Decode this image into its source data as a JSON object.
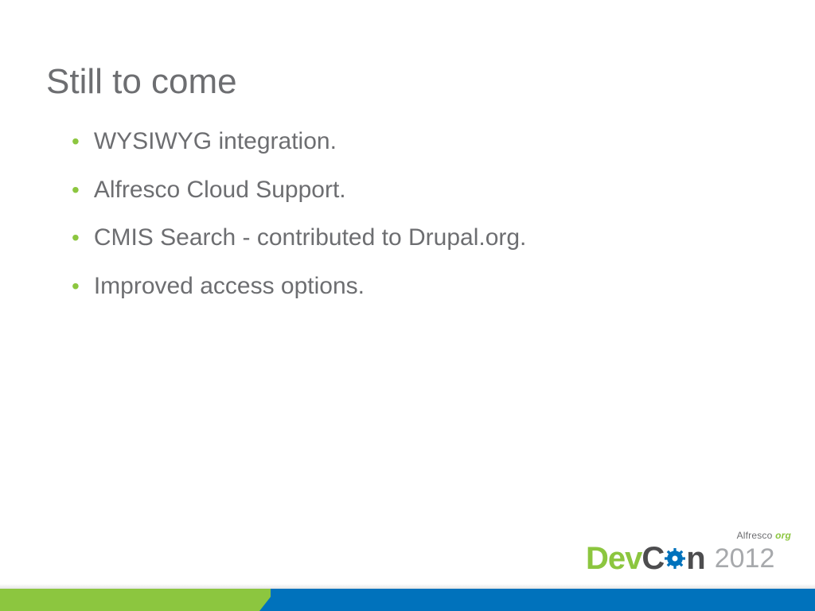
{
  "slide": {
    "title": "Still to come",
    "bullets": [
      "WYSIWYG integration.",
      "Alfresco Cloud Support.",
      "CMIS Search - contributed to Drupal.org.",
      "Improved access options."
    ]
  },
  "footer": {
    "brand_small_prefix": "Alfresco",
    "brand_small_suffix": "org",
    "logo_dev": "Dev",
    "logo_c": "C",
    "logo_n": "n",
    "year": "2012"
  },
  "colors": {
    "accent_green": "#8cc63f",
    "accent_blue": "#0072bc",
    "text_gray": "#6d6e71"
  }
}
